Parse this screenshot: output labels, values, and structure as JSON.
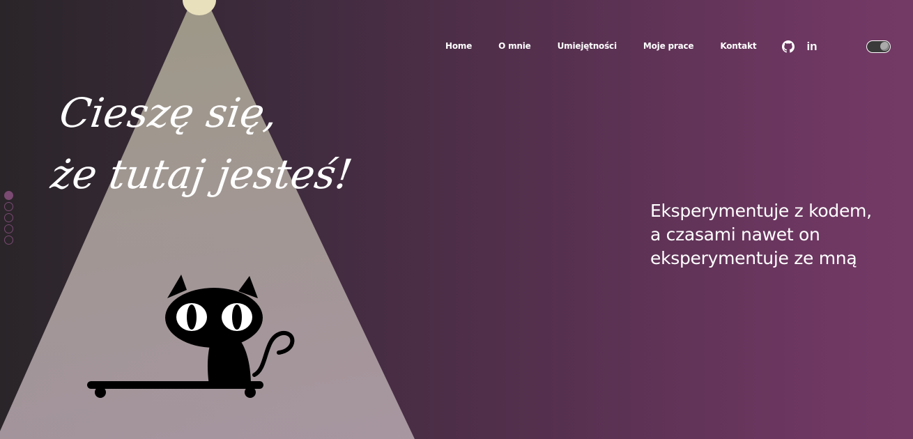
{
  "nav": {
    "items": [
      "Home",
      "O mnie",
      "Umiejętności",
      "Moje prace",
      "Kontakt"
    ]
  },
  "social": {
    "icons": [
      "github-icon",
      "linkedin-icon"
    ],
    "linkedin_label": "in"
  },
  "theme_toggle": {
    "state": "dark"
  },
  "hero": {
    "greeting_line1": "Cieszę się,",
    "greeting_line2": "że tutaj jesteś!",
    "tagline_line1": "Eksperymentuje z kodem,",
    "tagline_line2": "a czasami nawet on",
    "tagline_line3": "eksperymentuje ze mną"
  },
  "pagination": {
    "count": 5,
    "active_index": 0
  },
  "colors": {
    "spotlight": "#e8e0bc",
    "accent": "#7a4a72",
    "background_left": "#2a2529",
    "background_right": "#743a66"
  }
}
